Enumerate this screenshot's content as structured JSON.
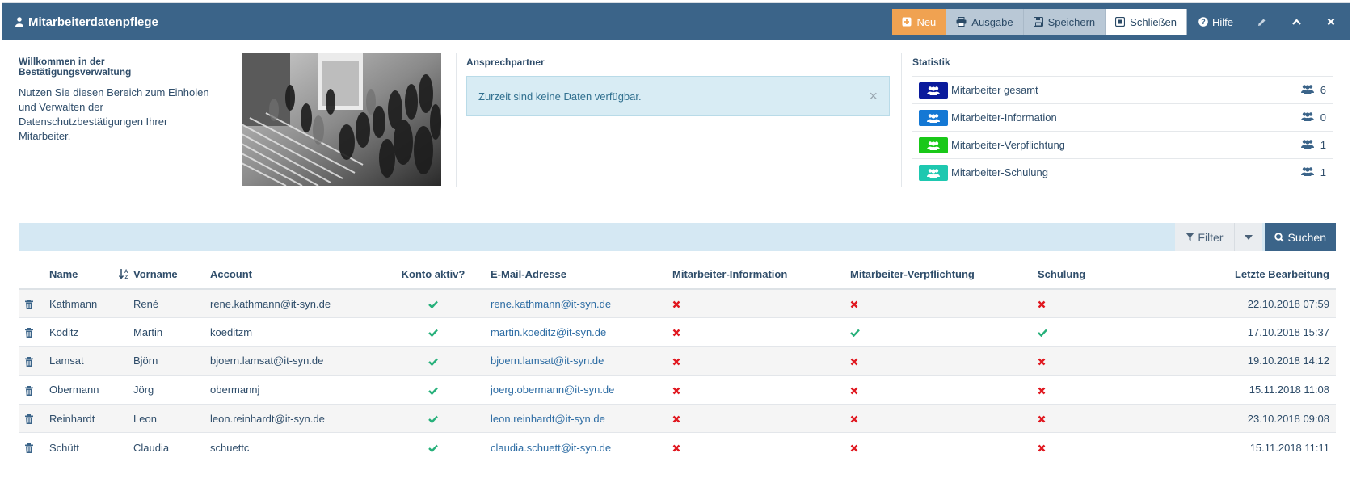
{
  "header": {
    "title": "Mitarbeiterdatenpflege",
    "buttons": {
      "neu": "Neu",
      "ausgabe": "Ausgabe",
      "speichern": "Speichern",
      "schliessen": "Schließen",
      "hilfe": "Hilfe"
    }
  },
  "welcome": {
    "title": "Willkommen in der Bestätigungsverwaltung",
    "text": "Nutzen Sie diesen Bereich zum Einholen und Verwalten der Datenschutzbestätigungen Ihrer Mitarbeiter."
  },
  "contact": {
    "title": "Ansprechpartner",
    "alert": "Zurzeit sind keine Daten verfügbar."
  },
  "stats": {
    "title": "Statistik",
    "items": [
      {
        "label": "Mitarbeiter gesamt",
        "count": "6",
        "color": "#0a1a9c"
      },
      {
        "label": "Mitarbeiter-Information",
        "count": "0",
        "color": "#1478d4"
      },
      {
        "label": "Mitarbeiter-Verpflichtung",
        "count": "1",
        "color": "#19c819"
      },
      {
        "label": "Mitarbeiter-Schulung",
        "count": "1",
        "color": "#1ec8b0"
      }
    ]
  },
  "search": {
    "filter_label": "Filter",
    "search_label": "Suchen"
  },
  "table": {
    "columns": {
      "name": "Name",
      "vorname": "Vorname",
      "account": "Account",
      "konto": "Konto aktiv?",
      "email": "E-Mail-Adresse",
      "info": "Mitarbeiter-Information",
      "verpflichtung": "Mitarbeiter-Verpflichtung",
      "schulung": "Schulung",
      "letzte": "Letzte Bearbeitung"
    },
    "rows": [
      {
        "name": "Kathmann",
        "vorname": "René",
        "account": "rene.kathmann@it-syn.de",
        "konto": true,
        "email": "rene.kathmann@it-syn.de",
        "info": false,
        "verpflichtung": false,
        "schulung": false,
        "letzte": "22.10.2018 07:59"
      },
      {
        "name": "Köditz",
        "vorname": "Martin",
        "account": "koeditzm",
        "konto": true,
        "email": "martin.koeditz@it-syn.de",
        "info": false,
        "verpflichtung": true,
        "schulung": true,
        "letzte": "17.10.2018 15:37"
      },
      {
        "name": "Lamsat",
        "vorname": "Björn",
        "account": "bjoern.lamsat@it-syn.de",
        "konto": true,
        "email": "bjoern.lamsat@it-syn.de",
        "info": false,
        "verpflichtung": false,
        "schulung": false,
        "letzte": "19.10.2018 14:12"
      },
      {
        "name": "Obermann",
        "vorname": "Jörg",
        "account": "obermannj",
        "konto": true,
        "email": "joerg.obermann@it-syn.de",
        "info": false,
        "verpflichtung": false,
        "schulung": false,
        "letzte": "15.11.2018 11:08"
      },
      {
        "name": "Reinhardt",
        "vorname": "Leon",
        "account": "leon.reinhardt@it-syn.de",
        "konto": true,
        "email": "leon.reinhardt@it-syn.de",
        "info": false,
        "verpflichtung": false,
        "schulung": false,
        "letzte": "23.10.2018 09:08"
      },
      {
        "name": "Schütt",
        "vorname": "Claudia",
        "account": "schuettc",
        "konto": true,
        "email": "claudia.schuett@it-syn.de",
        "info": false,
        "verpflichtung": false,
        "schulung": false,
        "letzte": "15.11.2018 11:11"
      }
    ]
  },
  "colors": {
    "header_bg": "#3b6489",
    "accent_orange": "#f0a251",
    "check_green": "#26b07a",
    "cross_red": "#e0171f"
  }
}
